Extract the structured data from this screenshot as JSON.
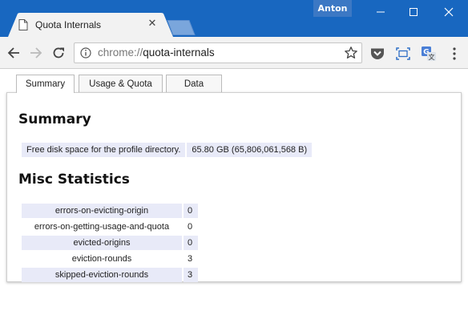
{
  "window": {
    "profile_name": "Anton"
  },
  "browser_tab": {
    "title": "Quota Internals",
    "close_glyph": "✕"
  },
  "toolbar": {
    "url_scheme": "chrome://",
    "url_host": "quota-internals"
  },
  "page_tabs": [
    {
      "label": "Summary",
      "selected": true
    },
    {
      "label": "Usage & Quota",
      "selected": false
    },
    {
      "label": "Data",
      "selected": false
    }
  ],
  "summary": {
    "heading": "Summary",
    "rows": [
      {
        "label": "Free disk space for the profile directory.",
        "value": "65.80 GB (65,806,061,568 B)"
      }
    ]
  },
  "misc": {
    "heading": "Misc Statistics",
    "rows": [
      {
        "key": "errors-on-evicting-origin",
        "value": "0"
      },
      {
        "key": "errors-on-getting-usage-and-quota",
        "value": "0"
      },
      {
        "key": "evicted-origins",
        "value": "0"
      },
      {
        "key": "eviction-rounds",
        "value": "3"
      },
      {
        "key": "skipped-eviction-rounds",
        "value": "3"
      }
    ]
  },
  "colors": {
    "titlebar": "#1867c0",
    "row_highlight": "#e8eaf8"
  },
  "icons": {
    "page": "page-icon",
    "back": "back-arrow-icon",
    "forward": "forward-arrow-icon",
    "reload": "reload-icon",
    "info": "info-icon",
    "star": "star-icon",
    "pocket": "pocket-icon",
    "screenshot": "screen-capture-icon",
    "translate": "translate-icon",
    "menu": "kebab-menu-icon"
  }
}
